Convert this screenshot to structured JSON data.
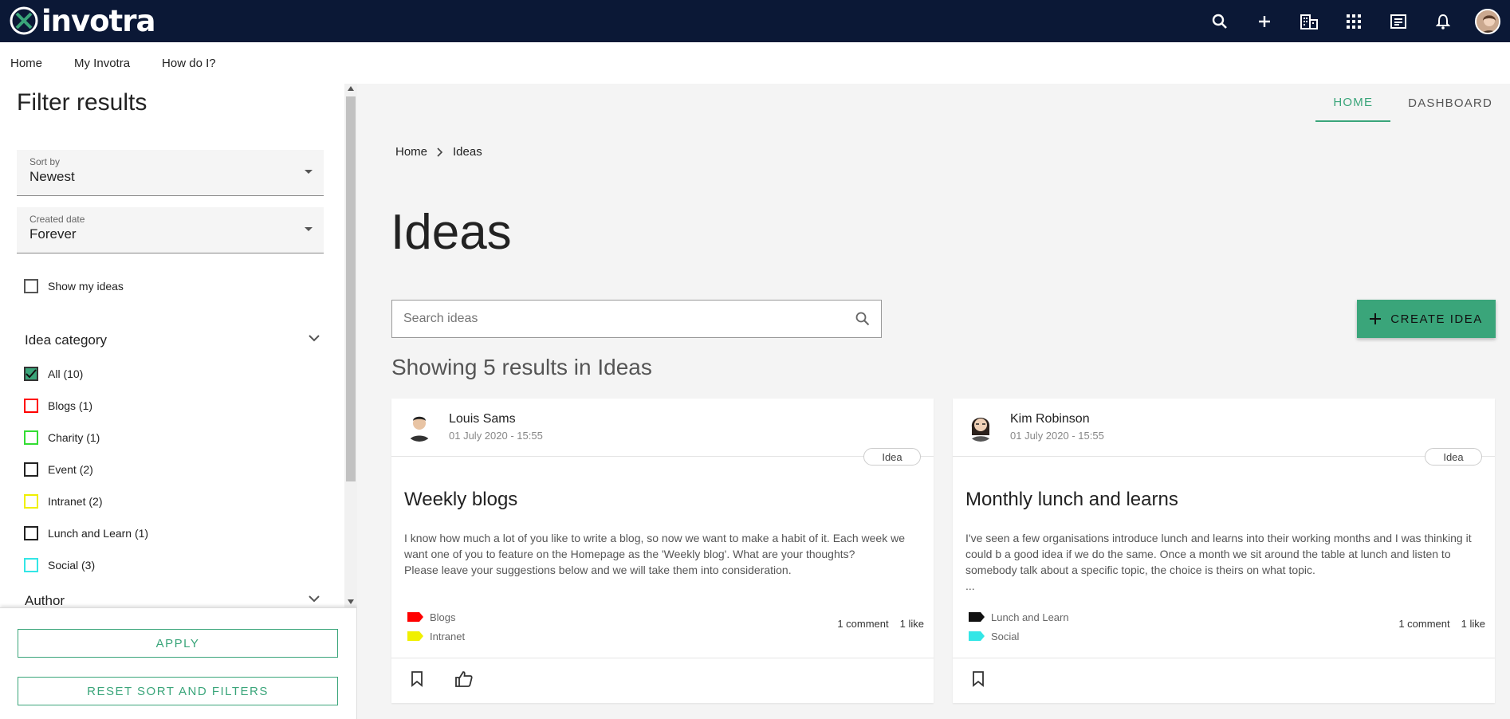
{
  "brand": {
    "name": "invotra"
  },
  "subnav": [
    "Home",
    "My Invotra",
    "How do I?"
  ],
  "sidebar": {
    "title": "Filter results",
    "sort": {
      "label": "Sort by",
      "value": "Newest"
    },
    "created": {
      "label": "Created date",
      "value": "Forever"
    },
    "show_mine": "Show my ideas",
    "category_head": "Idea category",
    "categories": [
      {
        "label": "All (10)",
        "color": "#3aa57a",
        "checked": true
      },
      {
        "label": "Blogs (1)",
        "color": "#ff0000",
        "checked": false
      },
      {
        "label": "Charity (1)",
        "color": "#33dd33",
        "checked": false
      },
      {
        "label": "Event (2)",
        "color": "#222222",
        "checked": false
      },
      {
        "label": "Intranet (2)",
        "color": "#f0f000",
        "checked": false
      },
      {
        "label": "Lunch and Learn (1)",
        "color": "#222222",
        "checked": false
      },
      {
        "label": "Social (3)",
        "color": "#33e6e6",
        "checked": false
      }
    ],
    "author_head": "Author",
    "apply": "APPLY",
    "reset": "RESET SORT AND FILTERS"
  },
  "tabs": {
    "home": "HOME",
    "dashboard": "DASHBOARD"
  },
  "breadcrumb": {
    "home": "Home",
    "current": "Ideas"
  },
  "page_title": "Ideas",
  "search": {
    "placeholder": "Search ideas"
  },
  "create_button": "CREATE IDEA",
  "results_text": "Showing 5 results in Ideas",
  "cards": [
    {
      "author": "Louis Sams",
      "date": "01 July 2020 - 15:55",
      "badge": "Idea",
      "title": "Weekly blogs",
      "body_1": "I know how much a lot of you like to write a blog, so now we want to make a habit of it. Each week we want one of you to feature on the Homepage as the 'Weekly blog'. What are your thoughts?",
      "body_2": "Please leave your suggestions below and we will take them into consideration.",
      "tags": [
        {
          "label": "Blogs",
          "color": "#ff0000"
        },
        {
          "label": "Intranet",
          "color": "#f0f000"
        }
      ],
      "comments": "1 comment",
      "likes": "1 like"
    },
    {
      "author": "Kim Robinson",
      "date": "01 July 2020 - 15:55",
      "badge": "Idea",
      "title": "Monthly lunch and learns",
      "body_1": "I've seen a few organisations introduce lunch and learns into their working months and I was thinking it could b a good idea if we do the same. Once a month we sit around the table at lunch and listen to somebody talk about a specific topic, the choice is theirs on what topic.",
      "body_2": "...",
      "tags": [
        {
          "label": "Lunch and Learn",
          "color": "#111111"
        },
        {
          "label": "Social",
          "color": "#33e6e6"
        }
      ],
      "comments": "1 comment",
      "likes": "1 like"
    }
  ],
  "colors": {
    "accent": "#3aa57a",
    "topbar": "#0b1836"
  }
}
